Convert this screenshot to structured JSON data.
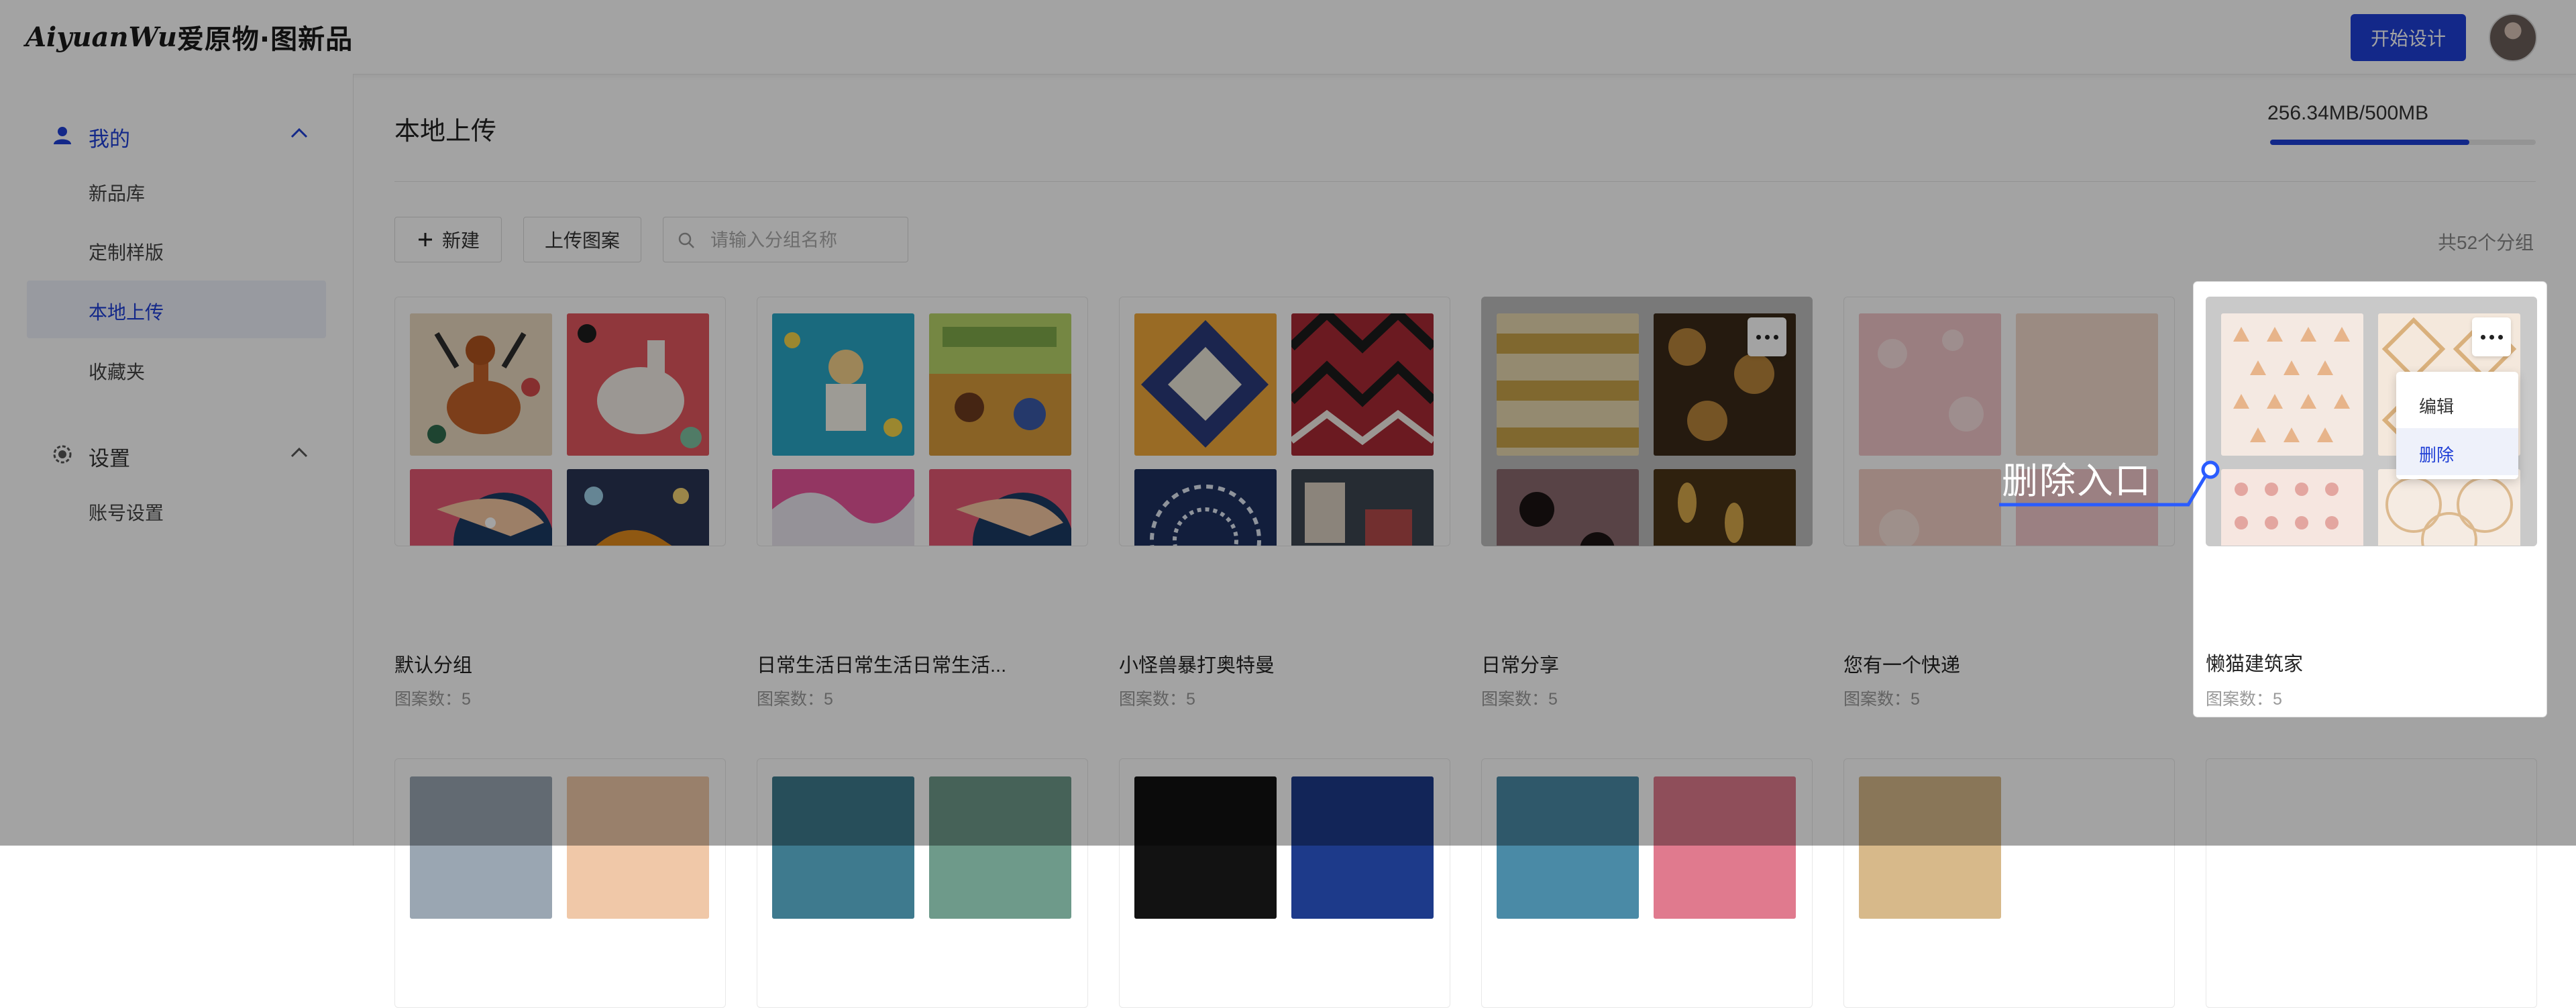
{
  "header": {
    "logo_script": "AiyuanWu",
    "logo_cn": "爱原物·图新品",
    "start_button": "开始设计"
  },
  "sidebar": {
    "group_mine": "我的",
    "items": [
      "新品库",
      "定制样版",
      "本地上传",
      "收藏夹"
    ],
    "active_item": "本地上传",
    "group_settings": "设置",
    "settings_items": [
      "账号设置"
    ]
  },
  "main": {
    "title": "本地上传",
    "storage": "256.34MB/500MB",
    "storage_used_fraction": 0.75,
    "new_button": "新建",
    "upload_button": "上传图案",
    "search_placeholder": "请输入分组名称",
    "total_groups": "共52个分组"
  },
  "cards": [
    {
      "name": "默认分组",
      "count": "图案数：5"
    },
    {
      "name": "日常生活日常生活日常生活...",
      "count": "图案数：5"
    },
    {
      "name": "小怪兽暴打奥特曼",
      "count": "图案数：5"
    },
    {
      "name": "日常分享",
      "count": "图案数：5"
    },
    {
      "name": "您有一个快递",
      "count": "图案数：5"
    },
    {
      "name": "懒猫建筑家",
      "count": "图案数：5"
    }
  ],
  "context_menu": {
    "edit": "编辑",
    "delete": "删除"
  },
  "annotation": "删除入口",
  "colors": {
    "accent": "#1f3fd6",
    "menu_hover_bg": "#eef1fa",
    "overlay": "rgba(0,0,0,0.36)"
  }
}
